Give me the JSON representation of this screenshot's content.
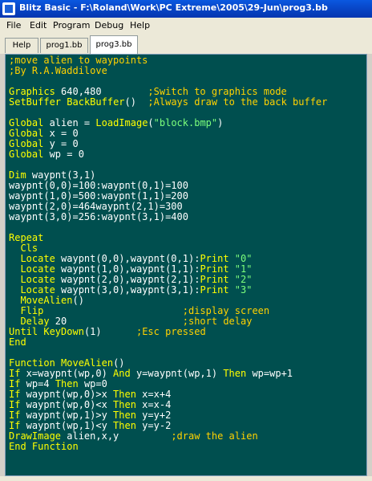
{
  "window": {
    "title": "Blitz Basic - F:\\Roland\\Work\\PC Extreme\\2005\\29-Jun\\prog3.bb"
  },
  "menu": [
    "File",
    "Edit",
    "Program",
    "Debug",
    "Help"
  ],
  "tabs": [
    "Help",
    "prog1.bb",
    "prog3.bb"
  ],
  "code": [
    ";move alien to waypoints",
    ";By R.A.Waddilove",
    "",
    "Graphics 640,480        ;Switch to graphics mode",
    "SetBuffer BackBuffer()  ;Always draw to the back buffer",
    "",
    "Global alien = LoadImage(\"block.bmp\")",
    "Global x = 0",
    "Global y = 0",
    "Global wp = 0",
    "",
    "Dim waypnt(3,1)",
    "waypnt(0,0)=100:waypnt(0,1)=100",
    "waypnt(1,0)=500:waypnt(1,1)=200",
    "waypnt(2,0)=464waypnt(2,1)=300",
    "waypnt(3,0)=256:waypnt(3,1)=400",
    "",
    "Repeat",
    "  Cls",
    "  Locate waypnt(0,0),waypnt(0,1):Print \"0\"",
    "  Locate waypnt(1,0),waypnt(1,1):Print \"1\"",
    "  Locate waypnt(2,0),waypnt(2,1):Print \"2\"",
    "  Locate waypnt(3,0),waypnt(3,1):Print \"3\"",
    "  MoveAlien()",
    "  Flip                        ;display screen",
    "  Delay 20                    ;short delay",
    "Until KeyDown(1)      ;Esc pressed",
    "End",
    "",
    "Function MoveAlien()",
    "If x=waypnt(wp,0) And y=waypnt(wp,1) Then wp=wp+1",
    "If wp=4 Then wp=0",
    "If waypnt(wp,0)>x Then x=x+4",
    "If waypnt(wp,0)<x Then x=x-4",
    "If waypnt(wp,1)>y Then y=y+2",
    "If waypnt(wp,1)<y Then y=y-2",
    "DrawImage alien,x,y         ;draw the alien",
    "End Function"
  ]
}
